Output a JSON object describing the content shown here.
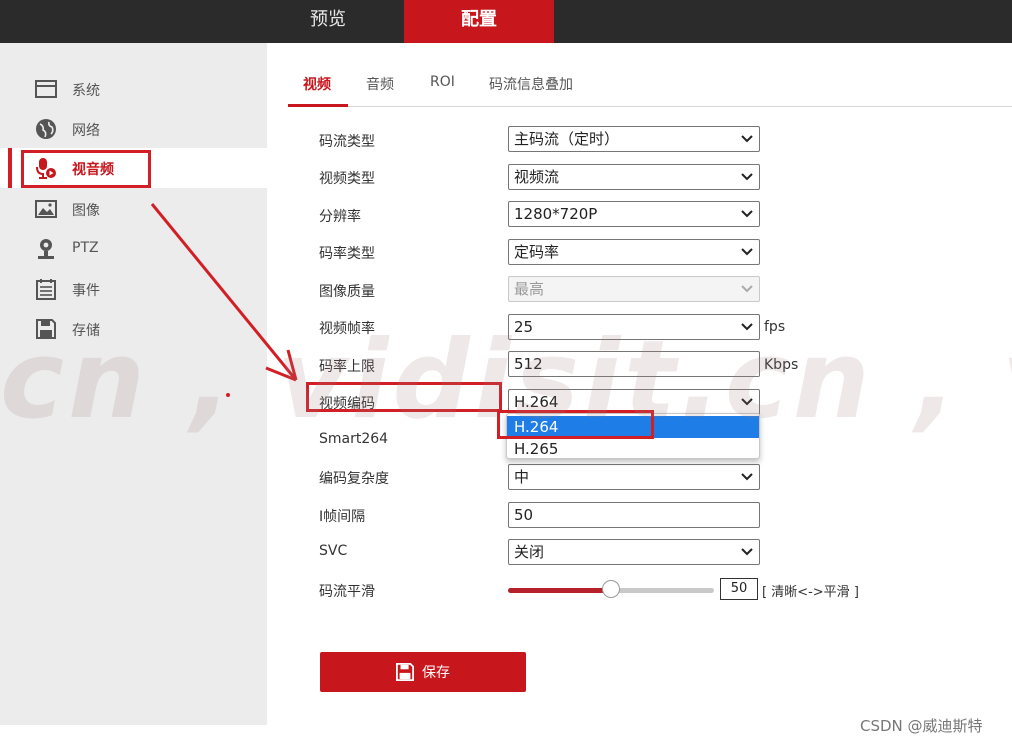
{
  "topnav": {
    "preview": "预览",
    "config": "配置"
  },
  "sidebar": {
    "items": [
      {
        "label": "系统",
        "icon": "system-window-icon"
      },
      {
        "label": "网络",
        "icon": "globe-icon"
      },
      {
        "label": "视音频",
        "icon": "microphone-icon",
        "active": true
      },
      {
        "label": "图像",
        "icon": "image-icon"
      },
      {
        "label": "PTZ",
        "icon": "ptz-camera-icon"
      },
      {
        "label": "事件",
        "icon": "calendar-icon"
      },
      {
        "label": "存储",
        "icon": "floppy-disk-icon"
      }
    ]
  },
  "tabs": [
    "视频",
    "音频",
    "ROI",
    "码流信息叠加"
  ],
  "form": {
    "stream_type": {
      "label": "码流类型",
      "value": "主码流（定时）"
    },
    "video_type": {
      "label": "视频类型",
      "value": "视频流"
    },
    "resolution": {
      "label": "分辨率",
      "value": "1280*720P"
    },
    "bitrate_type": {
      "label": "码率类型",
      "value": "定码率"
    },
    "image_quality": {
      "label": "图像质量",
      "value": "最高"
    },
    "frame_rate": {
      "label": "视频帧率",
      "value": "25",
      "unit": "fps"
    },
    "max_bitrate": {
      "label": "码率上限",
      "value": "512",
      "unit": "Kbps"
    },
    "video_encoding": {
      "label": "视频编码",
      "value": "H.264",
      "options": [
        "H.264",
        "H.265"
      ]
    },
    "smart264": {
      "label": "Smart264"
    },
    "complexity": {
      "label": "编码复杂度",
      "value": "中"
    },
    "i_frame": {
      "label": "I帧间隔",
      "value": "50"
    },
    "svc": {
      "label": "SVC",
      "value": "关闭"
    },
    "smoothing": {
      "label": "码流平滑",
      "value": "50",
      "level": 0.5,
      "hint": "[ 清晰<->平滑 ]"
    }
  },
  "save_label": "保存",
  "watermark": "cn , vidisit.cn , vic",
  "credit": "CSDN @威迪斯特",
  "colors": {
    "brand_red": "#c8161d",
    "annotation_red": "#d21f26",
    "topbar": "#2b2b2b",
    "sidebar_bg": "#ececec",
    "dropdown_highlight": "#1e7de6"
  }
}
